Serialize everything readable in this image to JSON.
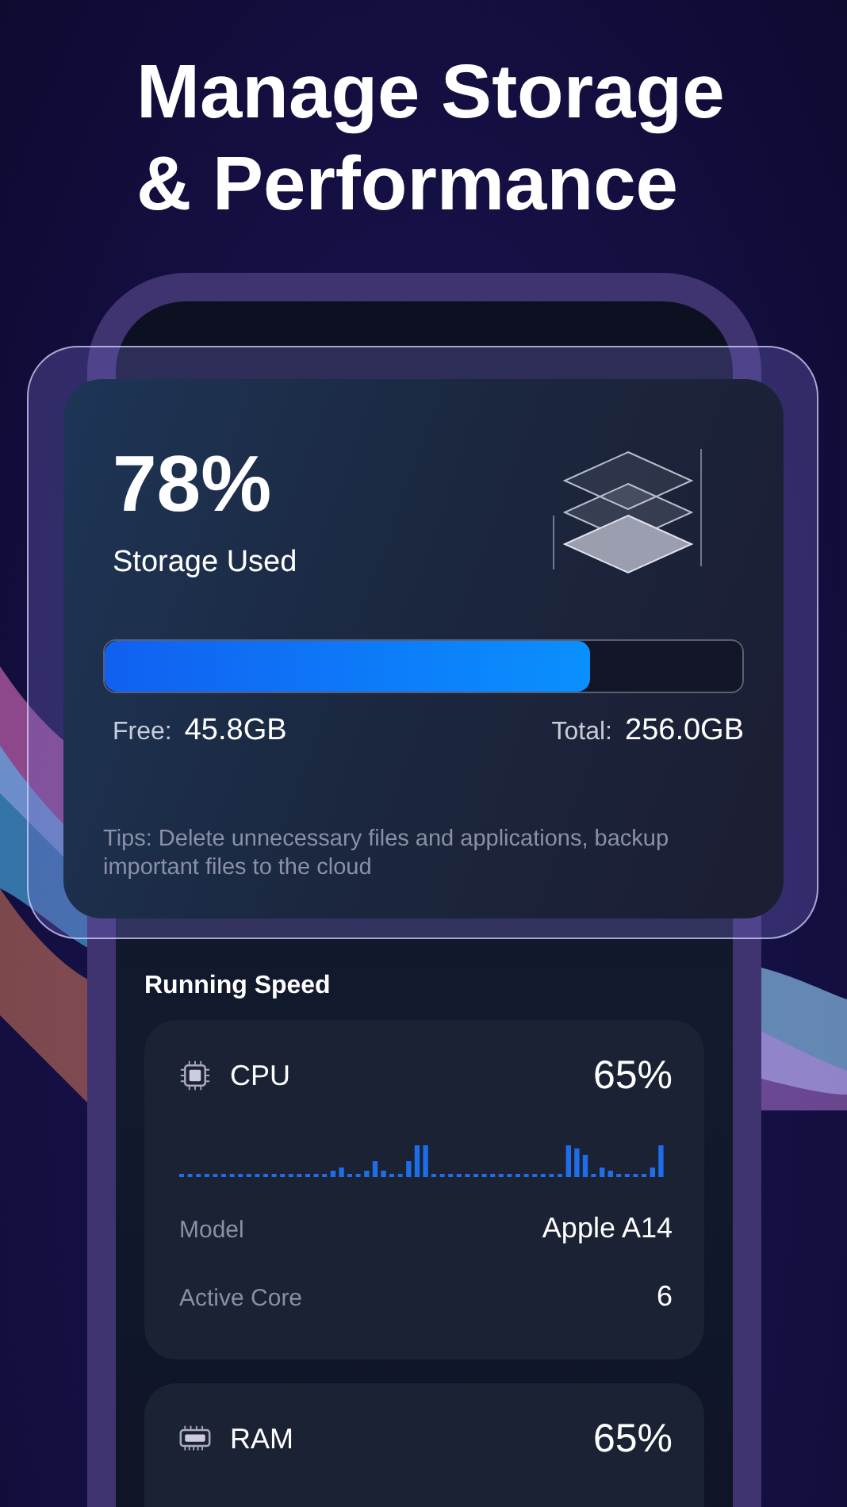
{
  "headline": [
    "Manage Storage",
    "& Performance"
  ],
  "storage": {
    "percent": "78%",
    "label": "Storage Used",
    "level": 0.76,
    "free_label": "Free:",
    "free_value": "45.8GB",
    "total_label": "Total:",
    "total_value": "256.0GB",
    "tips": "Tips: Delete unnecessary files and applications, backup important files to the cloud"
  },
  "running_speed": {
    "title": "Running Speed",
    "cards": [
      {
        "kind": "cpu",
        "name": "CPU",
        "percent": "65%",
        "rows": [
          {
            "label": "Model",
            "value": "Apple A14"
          },
          {
            "label": "Active Core",
            "value": "6"
          }
        ]
      },
      {
        "kind": "ram",
        "name": "RAM",
        "percent": "65%"
      }
    ]
  }
}
